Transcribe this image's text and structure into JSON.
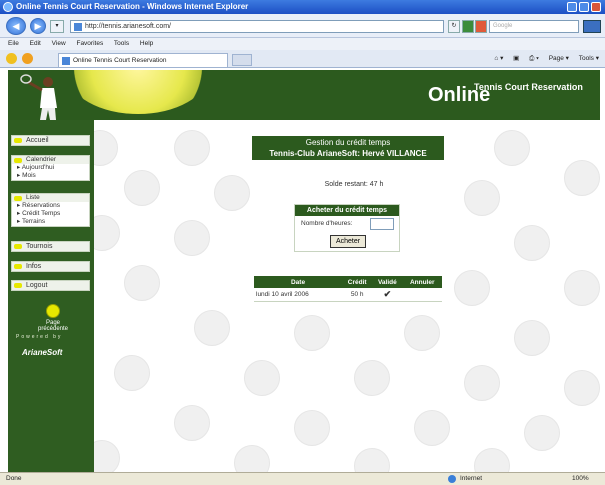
{
  "browser": {
    "title": "Online Tennis Court Reservation - Windows Internet Explorer",
    "url": "http://tennis.arianesoft.com/",
    "search_placeholder": "Google",
    "menu": [
      "Eile",
      "Edit",
      "View",
      "Favorites",
      "Tools",
      "Help"
    ],
    "tab_title": "Online Tennis Court Reservation",
    "tools": [
      "Page ▾",
      "Tools ▾"
    ],
    "status": "Done",
    "zone": "Internet",
    "zoom": "100%"
  },
  "header": {
    "online": "Online",
    "subtitle": "Tennis Court Reservation"
  },
  "sidebar": {
    "accueil": "Accueil",
    "calendrier": {
      "label": "Calendrier",
      "items": [
        "Aujourd'hui",
        "Mois"
      ]
    },
    "liste": {
      "label": "Liste",
      "items": [
        "Réservations",
        "Crédit Temps",
        "Terrains"
      ]
    },
    "tournois": "Tournois",
    "infos": "Infos",
    "logout": "Logout",
    "prev_page": "Page précédente",
    "powered_by": "Powered by",
    "ariane": "ArianeSoft"
  },
  "main": {
    "title_line1": "Gestion du crédit temps",
    "title_line2": "Tennis-Club ArianeSoft: Hervé VILLANCE",
    "solde": "Solde restant: 47 h",
    "buy": {
      "header": "Acheter du crédit temps",
      "hours_label": "Nombre d'heures:",
      "hours_value": "",
      "button": "Acheter"
    },
    "table": {
      "headers": [
        "Date",
        "Crédit",
        "Validé",
        "Annuler"
      ],
      "rows": [
        {
          "date": "lundi 10 avril 2006",
          "credit": "50 h",
          "valide": "✔",
          "annuler": ""
        }
      ]
    }
  }
}
